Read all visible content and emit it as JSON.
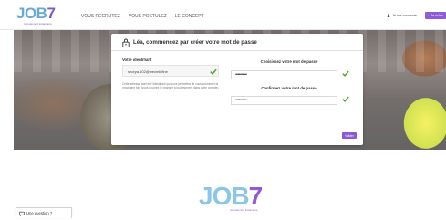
{
  "header": {
    "logo_text": "JOB",
    "logo_seven": "7",
    "logo_tagline": "recrutement instantané",
    "nav": [
      "VOUS RECRUTEZ",
      "VOUS POSTULEZ",
      "LE CONCEPT"
    ],
    "login_label": "Je me connecte",
    "signup_label": "Je m'ins"
  },
  "modal": {
    "title": "Léa, commencez par créer votre mot de passe",
    "identity_label": "Votre identifiant",
    "identity_value": "seorya.602@wecmk.fine",
    "help_text": "Cette adresse mail est l'identifiant qui vous permettra de vous connecter la prochaine fois (vous pourrez le changer à tout moment dans votre compte).",
    "password_label": "Choisissez votre mot de passe",
    "password_value": "••••••••••",
    "confirm_label": "Confirmez votre mot de passe",
    "confirm_value": "••••••••••",
    "submit_label": "Valider"
  },
  "footer": {
    "logo_text": "JOB",
    "logo_seven": "7",
    "logo_tagline": "recrutement instantané",
    "question_label": "Une question ?"
  },
  "colors": {
    "brand_purple": "#8f5bd6",
    "brand_blue": "#6aa8d8",
    "check_green": "#4aa82f"
  }
}
